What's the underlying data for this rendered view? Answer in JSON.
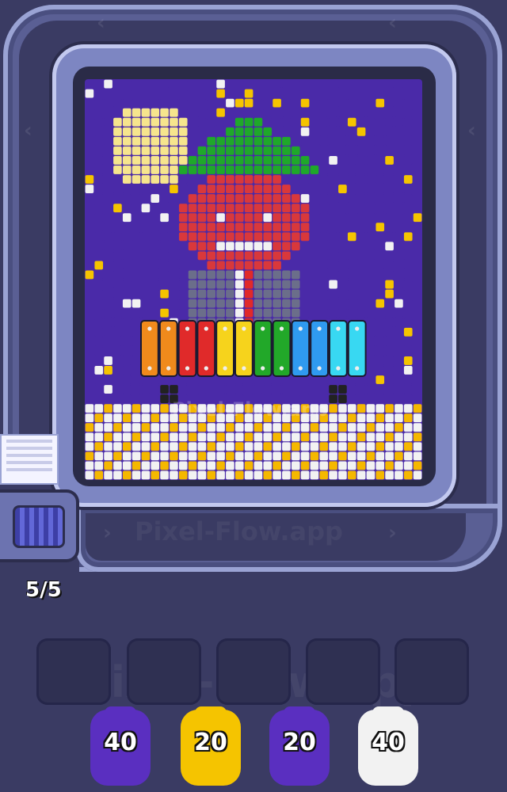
{
  "watermark": {
    "text": "Pixel-Flow.app"
  },
  "conveyor": {
    "direction_icon": "chevron-icon"
  },
  "queue": {
    "counter": "5/5"
  },
  "slots": [
    {
      "state": "empty"
    },
    {
      "state": "empty"
    },
    {
      "state": "empty"
    },
    {
      "state": "empty"
    },
    {
      "state": "empty"
    }
  ],
  "shooters": [
    {
      "color": "purple",
      "hex": "#5a2fc0",
      "count": "40"
    },
    {
      "color": "yellow",
      "hex": "#f5c400",
      "count": "20"
    },
    {
      "color": "purple",
      "hex": "#5a2fc0",
      "count": "20"
    },
    {
      "color": "white",
      "hex": "#f2f2f2",
      "count": "40"
    }
  ],
  "palette": {
    "background": "#4a2aa8",
    "moon": "#f6e58d",
    "star": "#f5c400",
    "leaf": "#1fa82a",
    "face": "#d9383b",
    "suit": "#6b6e8a",
    "floor_white": "#f2f2f2",
    "floor_gold": "#f5b800"
  },
  "xylophone": {
    "bars": [
      "#f08a1c",
      "#f08a1c",
      "#e02a2a",
      "#e02a2a",
      "#f6d31c",
      "#f6d31c",
      "#22a829",
      "#22a829",
      "#2f9af0",
      "#2f9af0",
      "#38d8f2",
      "#38d8f2"
    ]
  }
}
